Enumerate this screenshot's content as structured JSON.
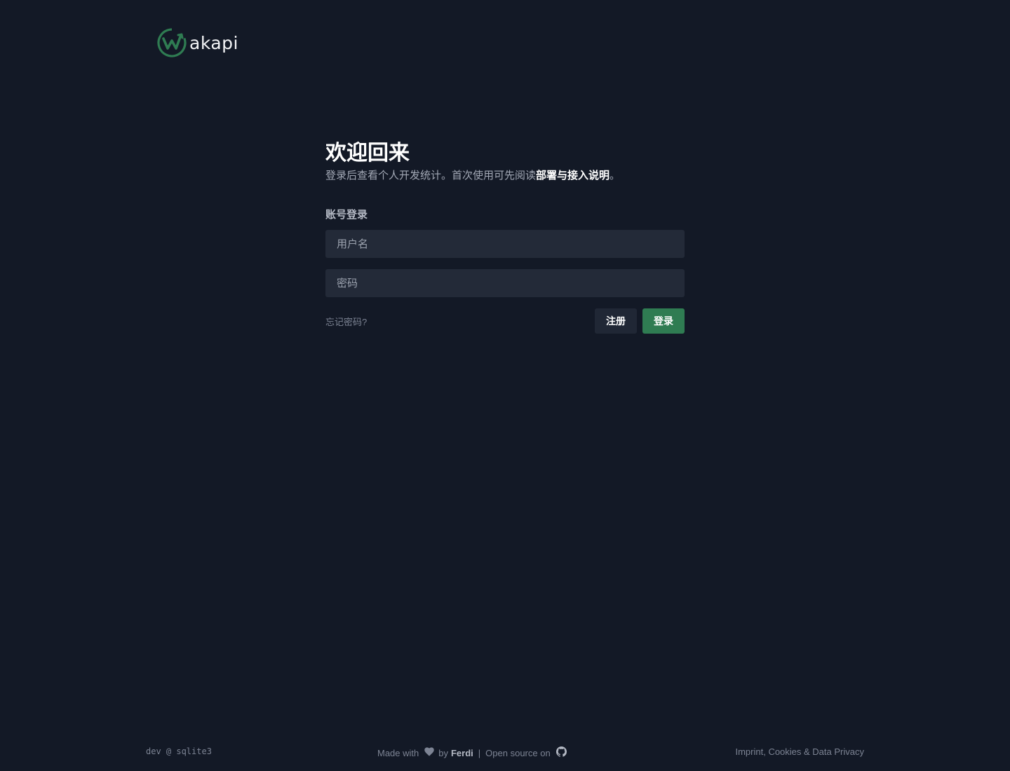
{
  "logo": {
    "text": "akapi",
    "icon": "wakapi-logo-icon"
  },
  "main": {
    "title": "欢迎回来",
    "subtitle_text": "登录后查看个人开发统计。首次使用可先阅读",
    "subtitle_link": "部署与接入说明",
    "subtitle_end": "。",
    "section_label": "账号登录",
    "username_placeholder": "用户名",
    "password_placeholder": "密码",
    "forgot_link": "忘记密码?",
    "register_label": "注册",
    "login_label": "登录"
  },
  "footer": {
    "left": "dev @ sqlite3",
    "made_with": "Made with",
    "heart_icon": "heart-icon",
    "by": "by",
    "author": "Ferdi",
    "separator": "|",
    "open_source": "Open source on",
    "github_icon": "github-icon",
    "right": "Imprint, Cookies & Data Privacy"
  },
  "colors": {
    "background": "#131926",
    "input_bg": "#232a38",
    "accent": "#2f7c52",
    "muted_text": "#7d8494"
  }
}
